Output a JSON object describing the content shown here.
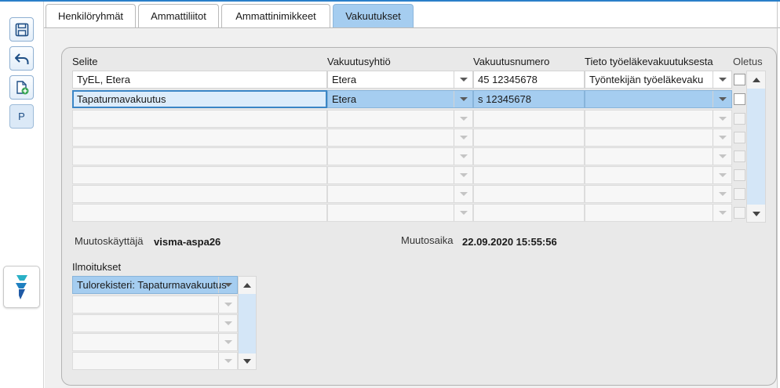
{
  "toolbar": {
    "save_icon": "save-icon",
    "undo_icon": "undo-icon",
    "new_record_icon": "add-document-icon",
    "p_label": "P",
    "app_logo_icon": "visma-logo-icon"
  },
  "tabs": [
    {
      "label": "Henkilöryhmät",
      "active": false
    },
    {
      "label": "Ammattiliitot",
      "active": false
    },
    {
      "label": "Ammattinimikkeet",
      "active": false
    },
    {
      "label": "Vakuutukset",
      "active": true
    }
  ],
  "grid": {
    "headers": {
      "selite": "Selite",
      "yhtio": "Vakuutusyhtiö",
      "numero": "Vakuutusnumero",
      "tieto": "Tieto työeläkevakuutuksesta",
      "oletus": "Oletus"
    },
    "rows": [
      {
        "selite": "TyEL, Etera",
        "yhtio": "Etera",
        "numero": "45 12345678",
        "tieto": "Työntekijän työeläkevaku",
        "oletus": false
      },
      {
        "selite": "Tapaturmavakuutus",
        "yhtio": "Etera",
        "numero": "s 12345678",
        "tieto": "",
        "oletus": false
      }
    ]
  },
  "meta": {
    "changed_by_label": "Muutoskäyttäjä",
    "changed_by_value": "visma-aspa26",
    "changed_at_label": "Muutosaika",
    "changed_at_value": "22.09.2020 15:55:56"
  },
  "notices": {
    "label": "Ilmoitukset",
    "items": [
      "Tulorekisteri: Tapaturmavakuutus"
    ]
  },
  "colors": {
    "accent": "#a5cdf0",
    "focus_border": "#3b86c6",
    "top_line": "#2a7fc9"
  }
}
